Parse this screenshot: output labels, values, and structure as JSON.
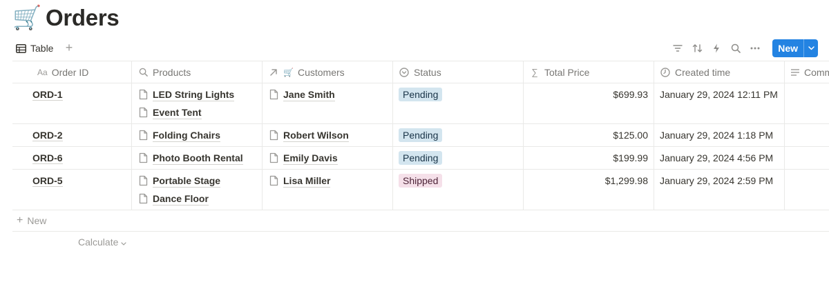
{
  "page": {
    "emoji": "🛒",
    "title": "Orders"
  },
  "view": {
    "tab_label": "Table",
    "tab_icon": "table-icon",
    "add_view_icon": "plus-icon"
  },
  "toolbar": {
    "icons": [
      "filter-icon",
      "sort-icon",
      "lightning-icon",
      "search-icon",
      "more-icon"
    ],
    "new_label": "New"
  },
  "columns": {
    "order_id": "Order ID",
    "products": "Products",
    "customers": "Customers",
    "customers_emoji": "🛒",
    "status": "Status",
    "total_price": "Total Price",
    "created_time": "Created time",
    "comments": "Comm"
  },
  "rows": [
    {
      "id": "ORD-1",
      "products": [
        "LED String Lights",
        "Event Tent"
      ],
      "customer": "Jane Smith",
      "status": "Pending",
      "price": "$699.93",
      "created": "January 29, 2024 12:11 PM"
    },
    {
      "id": "ORD-2",
      "products": [
        "Folding Chairs"
      ],
      "customer": "Robert Wilson",
      "status": "Pending",
      "price": "$125.00",
      "created": "January 29, 2024 1:18 PM"
    },
    {
      "id": "ORD-6",
      "products": [
        "Photo Booth Rental"
      ],
      "customer": "Emily Davis",
      "status": "Pending",
      "price": "$199.99",
      "created": "January 29, 2024 4:56 PM"
    },
    {
      "id": "ORD-5",
      "products": [
        "Portable Stage",
        "Dance Floor"
      ],
      "customer": "Lisa Miller",
      "status": "Shipped",
      "price": "$1,299.98",
      "created": "January 29, 2024 2:59 PM"
    }
  ],
  "status_colors": {
    "Pending": "#d3e5ef",
    "Shipped": "#f5e0e9"
  },
  "footer": {
    "new_row_label": "New",
    "calculate_label": "Calculate"
  },
  "colors": {
    "accent": "#2383e2",
    "border": "#e9e9e7",
    "muted_text": "#787774"
  }
}
